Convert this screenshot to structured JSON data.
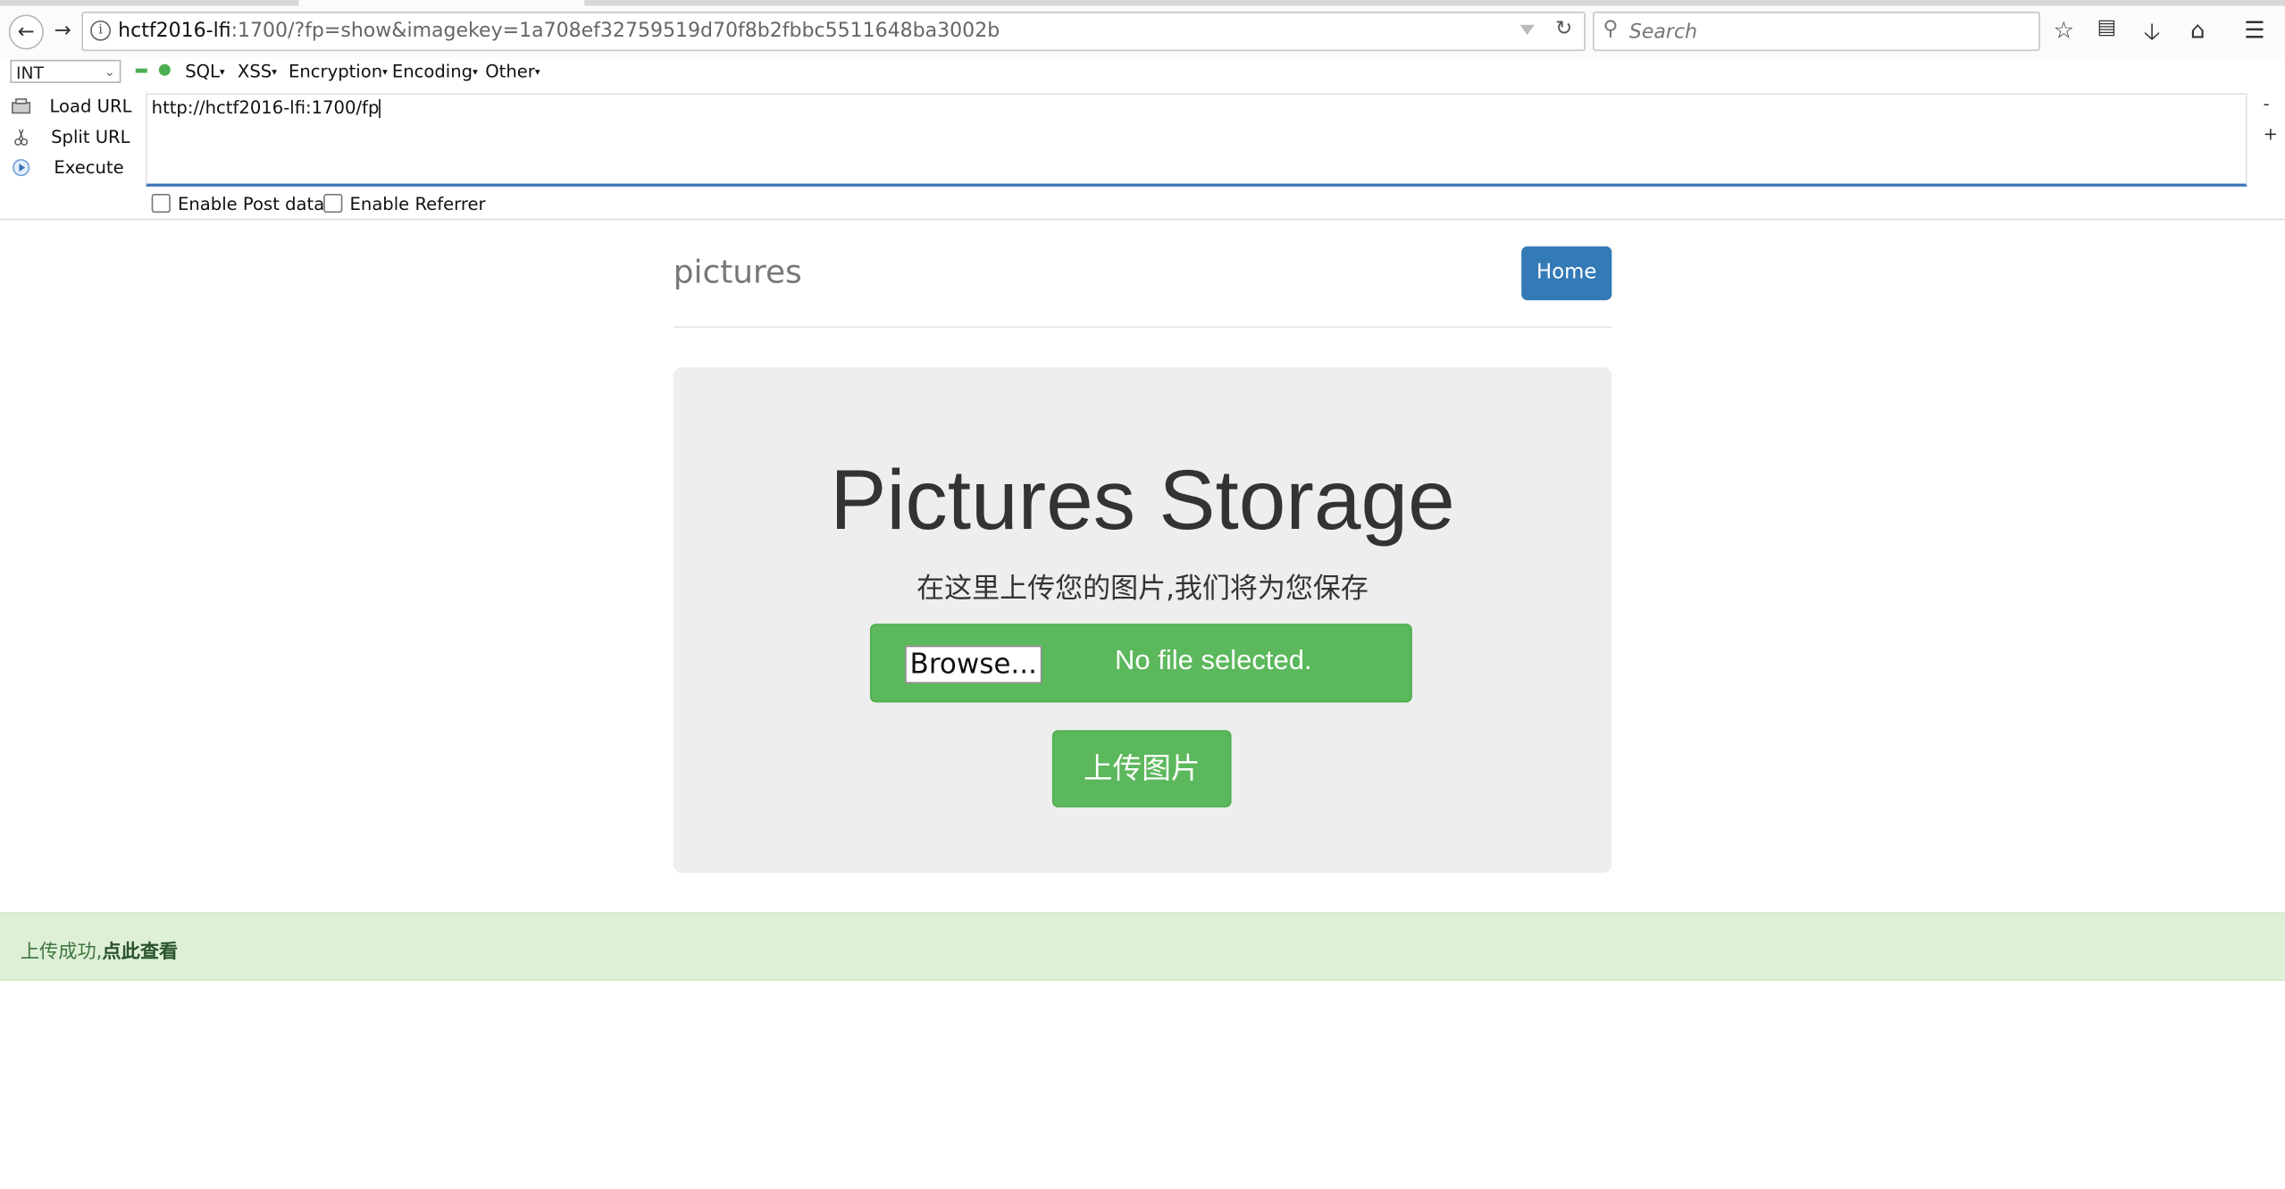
{
  "browser": {
    "url_host": "hctf2016-lfi",
    "url_rest": ":1700/?fp=show&imagekey=1a708ef32759519d70f8b2fbbc5511648ba3002b",
    "search_placeholder": "Search"
  },
  "hackbar": {
    "select_value": "INT",
    "menus": [
      "SQL",
      "XSS",
      "Encryption",
      "Encoding",
      "Other"
    ],
    "actions": [
      "Load URL",
      "Split URL",
      "Execute"
    ],
    "textarea_value": "http://hctf2016-lfi:1700/fp",
    "side_minus": "-",
    "side_plus": "+",
    "checkboxes": [
      "Enable Post data",
      "Enable Referrer"
    ]
  },
  "page": {
    "brand": "pictures",
    "home_button": "Home",
    "title": "Pictures Storage",
    "subtitle": "在这里上传您的图片,我们将为您保存",
    "browse_label": "Browse...",
    "no_file_text": "No file selected.",
    "upload_button": "上传图片",
    "alert_text": "上传成功,",
    "alert_link": "点此查看"
  },
  "colors": {
    "primary": "#337ab7",
    "success": "#5cb85c",
    "alert_bg": "#dff0d8",
    "alert_text": "#3c763d"
  }
}
